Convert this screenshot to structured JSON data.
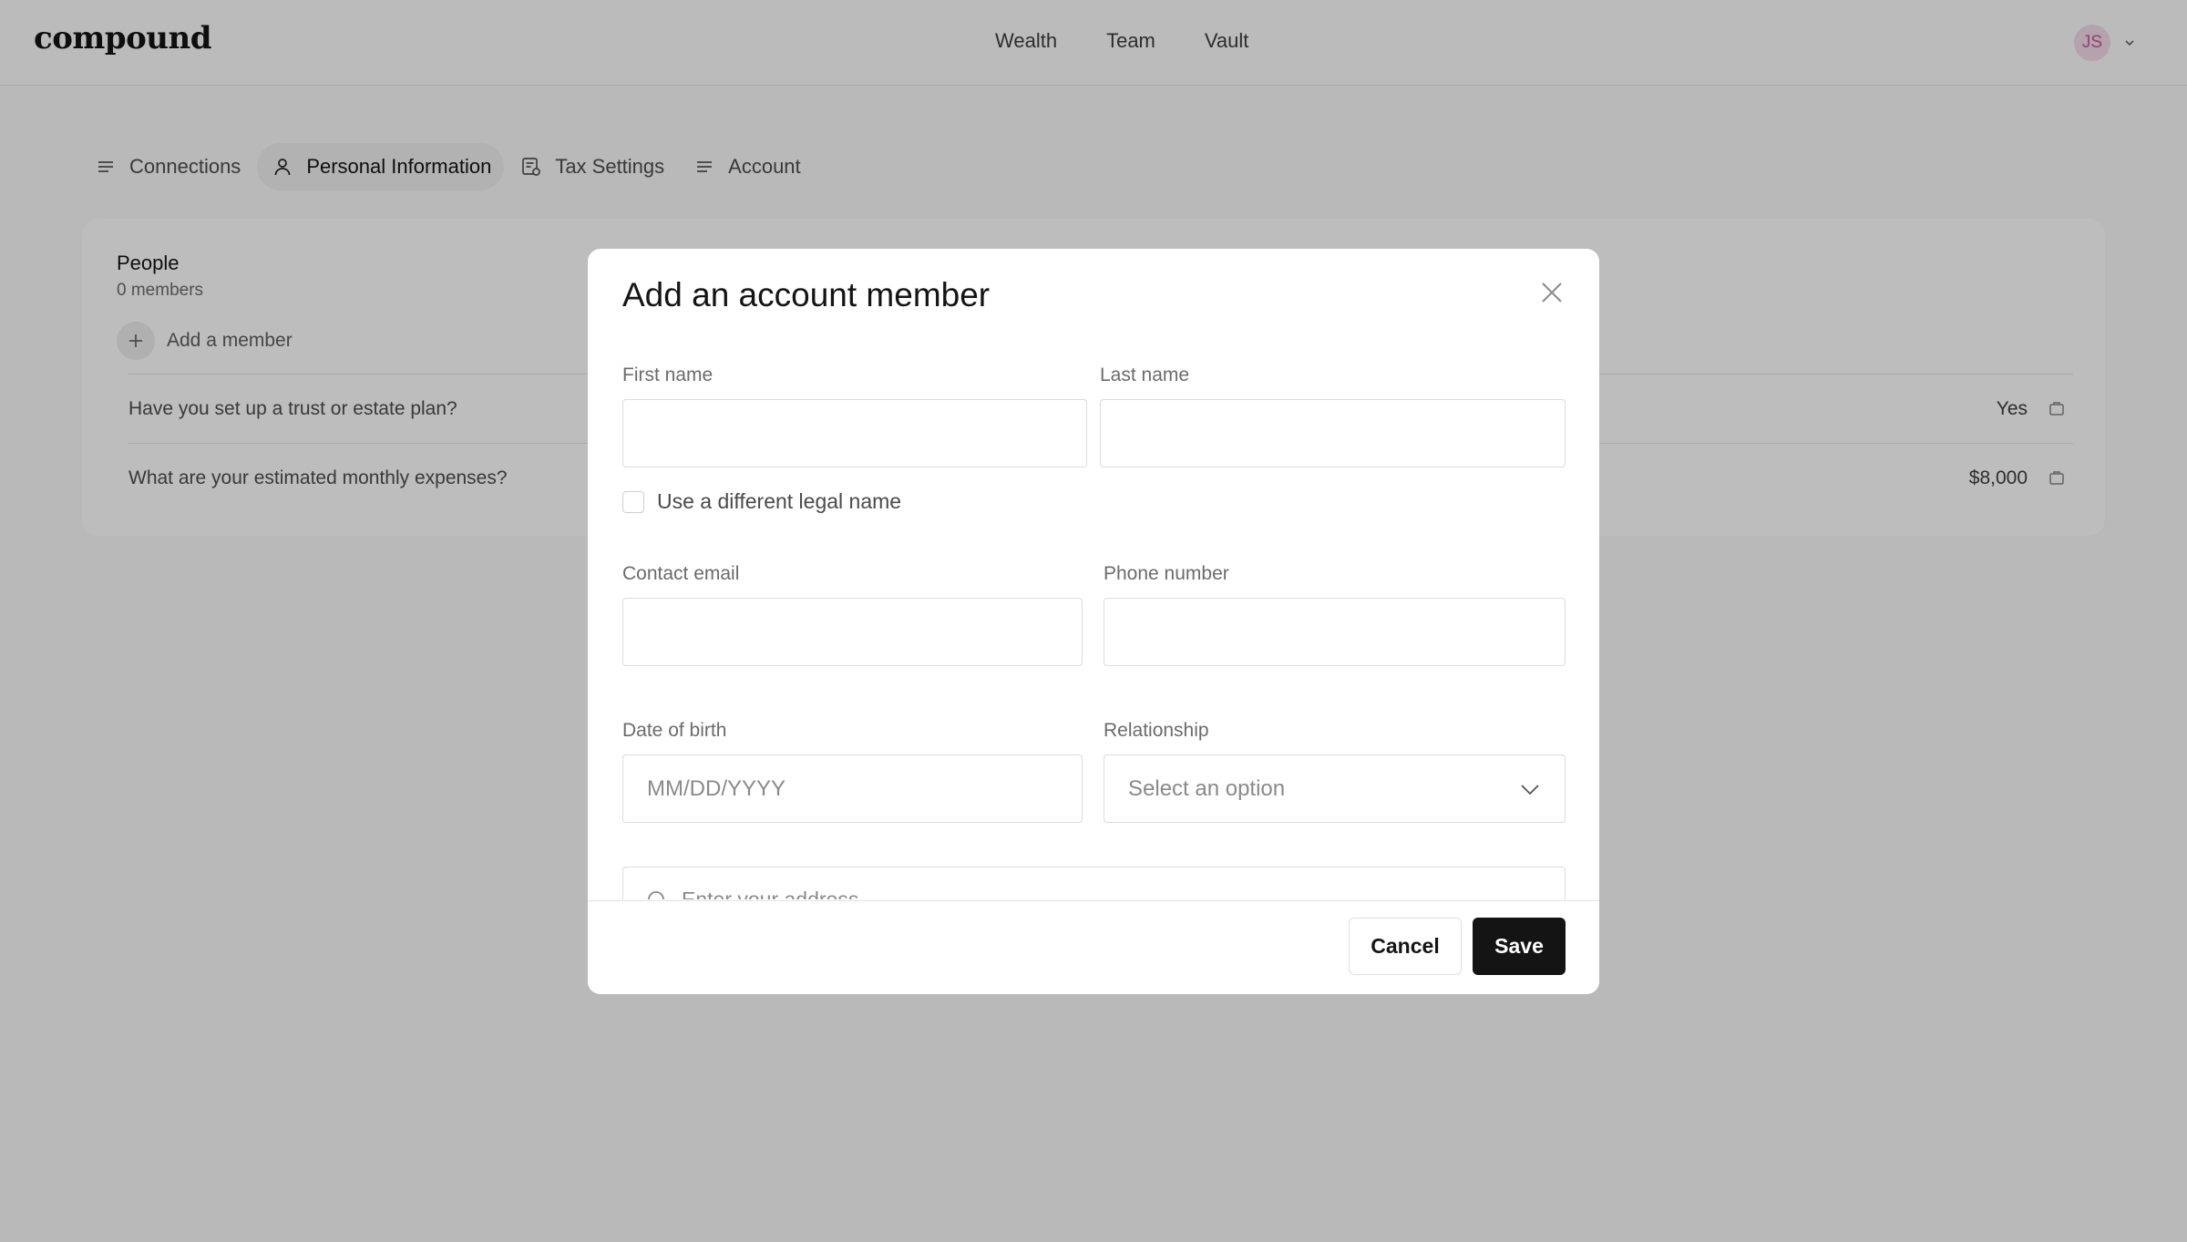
{
  "header": {
    "logo": "compound",
    "nav": [
      "Wealth",
      "Team",
      "Vault"
    ],
    "user_initials": "JS"
  },
  "tabs": [
    {
      "label": "Connections",
      "icon": "list-icon",
      "active": false
    },
    {
      "label": "Personal Information",
      "icon": "person-icon",
      "active": true
    },
    {
      "label": "Tax Settings",
      "icon": "tax-document-icon",
      "active": false
    },
    {
      "label": "Account",
      "icon": "list-icon",
      "active": false
    }
  ],
  "people_card": {
    "title": "People",
    "subtitle": "0 members",
    "add_member_label": "Add a member",
    "questions": [
      {
        "question": "Have you set up a trust or estate plan?",
        "answer": "Yes"
      },
      {
        "question": "What are your estimated monthly expenses?",
        "answer": "$8,000"
      }
    ]
  },
  "modal": {
    "title": "Add an account member",
    "first_name_label": "First name",
    "first_name_value": "",
    "last_name_label": "Last name",
    "last_name_value": "",
    "legal_name_checkbox_label": "Use a different legal name",
    "legal_name_checked": false,
    "contact_email_label": "Contact email",
    "contact_email_value": "",
    "phone_label": "Phone number",
    "phone_value": "",
    "dob_label": "Date of birth",
    "dob_placeholder": "MM/DD/YYYY",
    "relationship_label": "Relationship",
    "relationship_placeholder": "Select an option",
    "address_placeholder": "Enter your address",
    "cancel_label": "Cancel",
    "save_label": "Save"
  },
  "colors": {
    "accent_dark": "#141414",
    "avatar_bg": "#f3dbe8",
    "avatar_text": "#c0599a",
    "overlay": "rgba(0,0,0,0.26)"
  }
}
